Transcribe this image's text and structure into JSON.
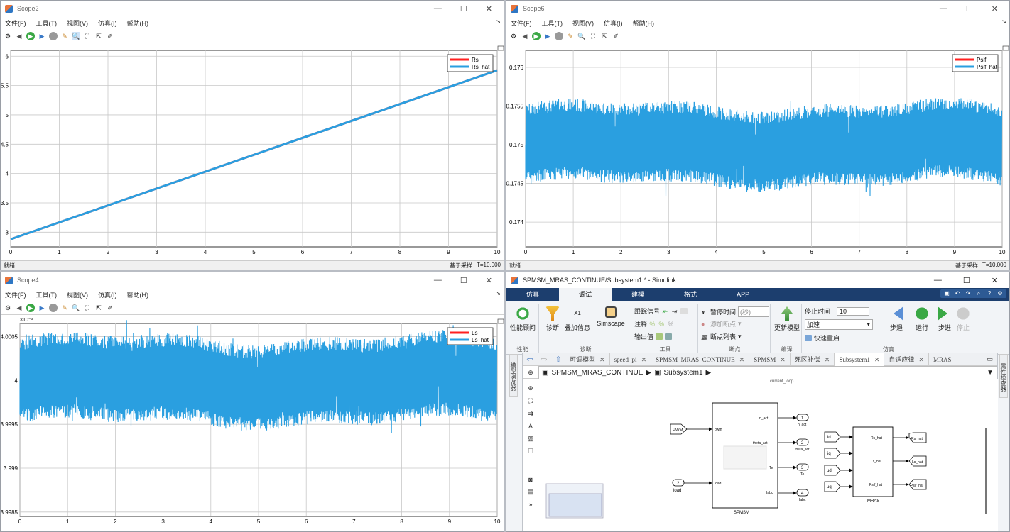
{
  "menu": {
    "file": "文件(F)",
    "tools": "工具(T)",
    "view": "视图(V)",
    "sim": "仿真(I)",
    "help": "帮助(H)"
  },
  "scope2": {
    "title": "Scope2",
    "status_left": "就绪",
    "status_mode": "基于采样",
    "status_time": "T=10.000",
    "chart_data": {
      "type": "line",
      "title": "",
      "xlim": [
        0,
        10
      ],
      "ylim": [
        2.75,
        6.1
      ],
      "xticks": [
        "0",
        "1",
        "2",
        "3",
        "4",
        "5",
        "6",
        "7",
        "8",
        "9",
        "10"
      ],
      "yticks": [
        "3",
        "3.5",
        "4",
        "4.5",
        "5",
        "5.5",
        "6"
      ],
      "legend": [
        "Rs",
        "Rs_hat"
      ],
      "legend_position": "top-right",
      "series": [
        {
          "name": "Rs",
          "color": "#ff2020",
          "x": [
            0,
            10
          ],
          "y": [
            2.88,
            5.76
          ]
        },
        {
          "name": "Rs_hat",
          "color": "#2a9fe0",
          "x": [
            0,
            10
          ],
          "y": [
            2.88,
            5.76
          ]
        }
      ]
    }
  },
  "scope6": {
    "title": "Scope6",
    "status_left": "就绪",
    "status_mode": "基于采样",
    "status_time": "T=10.000",
    "chart_data": {
      "type": "line",
      "title": "",
      "xlim": [
        0,
        10
      ],
      "ylim": [
        0.17368,
        0.17622
      ],
      "xticks": [
        "0",
        "1",
        "2",
        "3",
        "4",
        "5",
        "6",
        "7",
        "8",
        "9",
        "10"
      ],
      "yticks": [
        "0.174",
        "0.1745",
        "0.175",
        "0.1755",
        "0.176"
      ],
      "legend": [
        "Psif",
        "Psif_hat"
      ],
      "legend_position": "top-right",
      "series": [
        {
          "name": "Psif",
          "color": "#ff2020"
        },
        {
          "name": "Psif_hat",
          "color": "#2a9fe0",
          "center": 0.175,
          "band_low": 0.17455,
          "band_high": 0.1755
        }
      ]
    }
  },
  "scope4": {
    "title": "Scope4",
    "status_left": "就绪",
    "status_mode": "基于采样",
    "status_time": "T=10.000",
    "chart_data": {
      "type": "line",
      "title": "",
      "xlim": [
        0,
        10
      ],
      "ylim": [
        3.99845,
        4.00065
      ],
      "exponent": "×10⁻³",
      "xticks": [
        "0",
        "1",
        "2",
        "3",
        "4",
        "5",
        "6",
        "7",
        "8",
        "9",
        "10"
      ],
      "yticks": [
        "3.9985",
        "3.999",
        "3.9995",
        "4",
        "4.0005"
      ],
      "legend": [
        "Ls",
        "Ls_hat"
      ],
      "legend_position": "top-right",
      "series": [
        {
          "name": "Ls",
          "color": "#ff2020"
        },
        {
          "name": "Ls_hat",
          "color": "#2a9fe0",
          "center": 4.0,
          "band_low": 3.99955,
          "band_high": 4.00045
        }
      ]
    }
  },
  "simulink": {
    "title": "SPMSM_MRAS_CONTINUE/Subsystem1 * - Simulink",
    "tabs": [
      "仿真",
      "调试",
      "建模",
      "格式",
      "APP"
    ],
    "ribbon": {
      "perf": "性能顾问",
      "perf_grp": "性能",
      "diag": "诊断",
      "overlay": "叠加信息",
      "simscape": "Simscape",
      "diag_grp": "诊断",
      "trace": "跟踪信号",
      "annot": "注释",
      "out": "输出值",
      "tools_grp": "工具",
      "pause": "暂停时间",
      "pause_val": "(秒)",
      "addbp": "添加断点",
      "bplist": "断点列表",
      "bp_grp": "断点",
      "update": "更新模型",
      "compile_grp": "编译",
      "stoptime": "停止时间",
      "stoptime_val": "10",
      "mode": "加速",
      "fastrestart": "快速重启",
      "stepback": "步退",
      "run": "运行",
      "stepfwd": "步进",
      "stop": "停止",
      "sim_grp": "仿真"
    },
    "side_left": "模型浏览器",
    "side_right": "属性检查器",
    "model_tabs": [
      "可调模型",
      "speed_pi",
      "SPMSM_MRAS_CONTINUE",
      "SPMSM",
      "死区补偿",
      "Subsystem1",
      "自适应律",
      "MRAS"
    ],
    "crumb": [
      "SPMSM_MRAS_CONTINUE",
      "Subsystem1"
    ],
    "blocks": {
      "pwm": "PWM",
      "load_num": "2",
      "load": "load",
      "spmsm": "SPMSM",
      "mras": "MRAS",
      "spmsm_in": [
        "pwm",
        "load"
      ],
      "spmsm_out": [
        "n_act",
        "theta_act",
        "Te",
        "Iabc"
      ],
      "outs": [
        {
          "num": "1",
          "label": "n_act"
        },
        {
          "num": "2",
          "label": "theta_act"
        },
        {
          "num": "3",
          "label": "Te"
        },
        {
          "num": "4",
          "label": "Iabc"
        }
      ],
      "mras_in": [
        "id",
        "iq",
        "ud",
        "uq"
      ],
      "mras_out": [
        "Rs_hat",
        "Ls_hat",
        "Psif_hat"
      ],
      "topcut": "current_loop"
    }
  }
}
